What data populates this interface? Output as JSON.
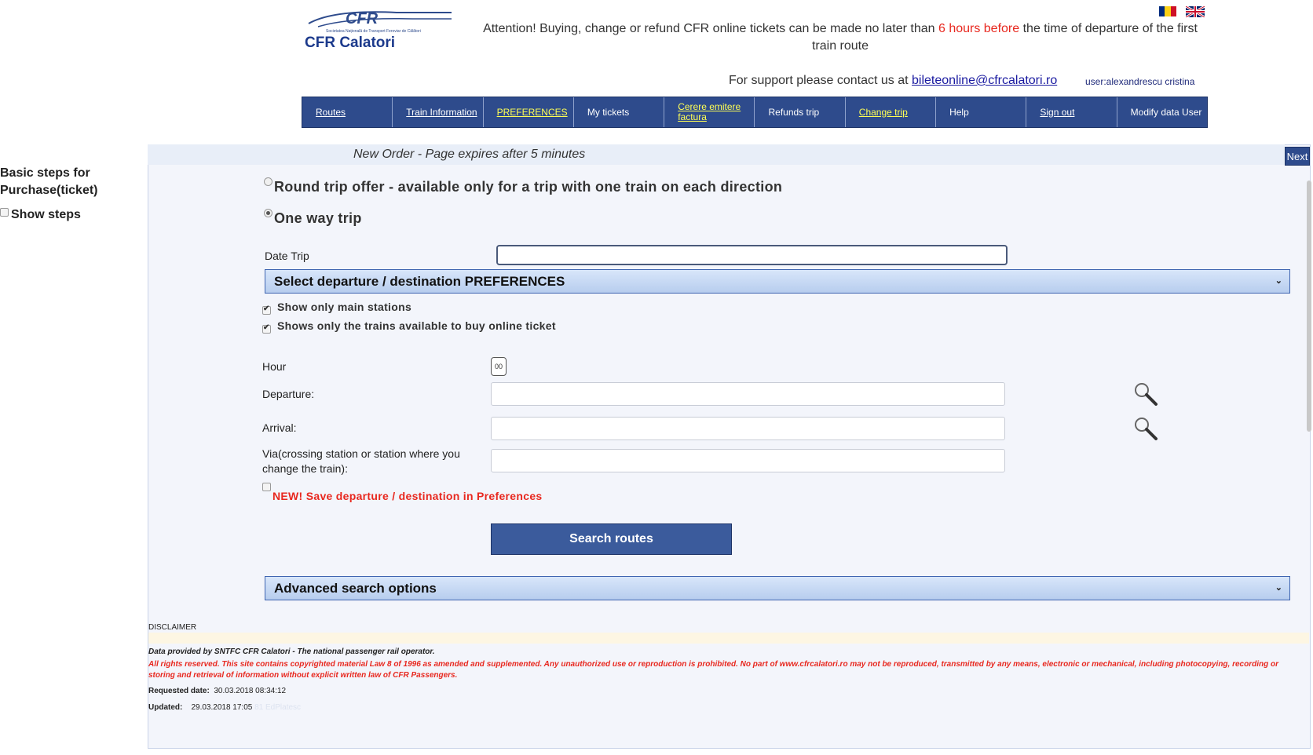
{
  "header": {
    "logo_top": "CFR",
    "logo_sub": "Societatea Națională de Transport Feroviar de Călători",
    "logo_main": "CFR Calatori",
    "attention_pre": "Attention! Buying, change or refund CFR online tickets can be made no later than ",
    "attention_red": "6 hours before",
    "attention_post": " the time of departure of the first train route",
    "support_text": "For support please contact us at ",
    "support_email": "bileteonline@cfrcalatori.ro",
    "user_label": "user:alexandrescu cristina"
  },
  "nav": {
    "routes": "Routes",
    "train_info": "Train Information",
    "preferences": "PREFERENCES",
    "my_tickets": "My tickets",
    "cerere": "Cerere emitere factura",
    "refunds": "Refunds trip",
    "change_trip": "Change trip",
    "help": "Help",
    "sign_out": "Sign out",
    "modify": "Modify data User"
  },
  "sidebar": {
    "basic_steps": "Basic steps for Purchase(ticket)",
    "show_steps": "Show steps"
  },
  "order": {
    "title": "New Order - Page expires after 5 minutes",
    "next": "Next",
    "round_trip": "Round trip offer - available only for a trip with one train on each direction",
    "one_way": "One way trip",
    "date_label": "Date Trip",
    "date_value": "",
    "preferences_section": "Select departure / destination PREFERENCES",
    "main_stations": "Show only main stations",
    "online_trains": "Shows only the trains available to buy online ticket",
    "hour_label": "Hour",
    "hour_value": "00",
    "departure_label": "Departure:",
    "arrival_label": "Arrival:",
    "via_label": "Via(crossing station or station where you change the train):",
    "save_pref": "NEW! Save departure / destination in Preferences",
    "search_button": "Search routes",
    "advanced_section": "Advanced search options"
  },
  "footer": {
    "disclaimer": "DISCLAIMER",
    "data_provided": "Data provided by SNTFC CFR Calatori - The national passenger rail operator.",
    "rights": "All rights reserved. This site contains copyrighted material Law 8 of 1996 as amended and supplemented. Any unauthorized use or reproduction is prohibited. No part of www.cfrcalatori.ro may not be reproduced, transmitted by any means, electronic or mechanical, including photocopying, recording or storing and retrieval of information without explicit written law of CFR Passengers.",
    "requested_label": "Requested date:",
    "requested_value": "30.03.2018 08:34:12",
    "updated_label": "Updated:",
    "updated_value": "29.03.2018 17:05",
    "updated_extra": "81 EdPlatesc"
  },
  "colors": {
    "nav_bg": "#2e4b8c",
    "accent_red": "#e8281f",
    "link_yellow": "#ffff55",
    "section_border": "#3e64b0"
  }
}
